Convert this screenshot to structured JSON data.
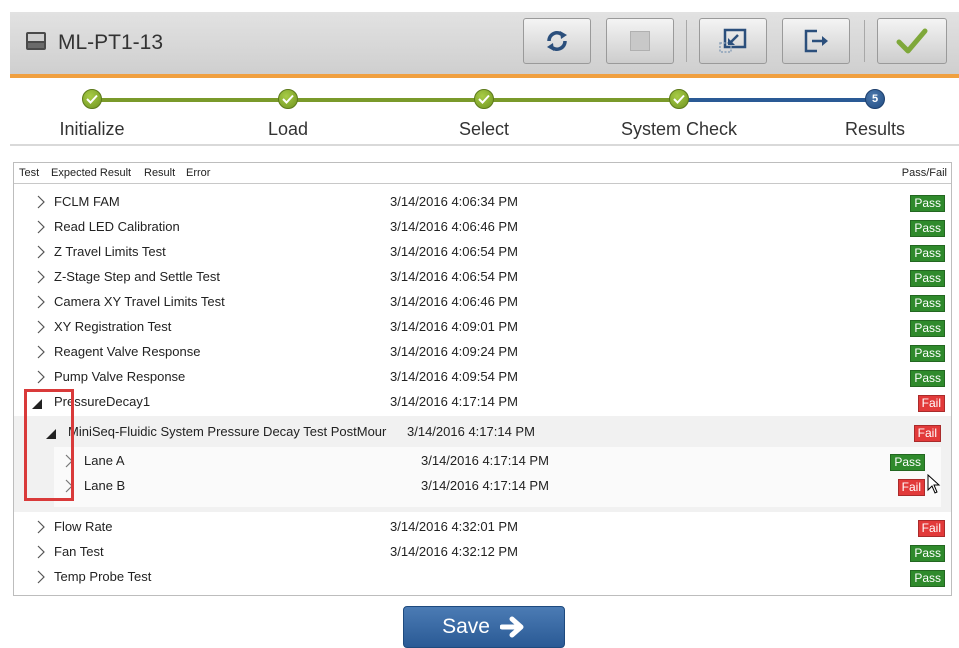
{
  "window": {
    "title": "ML-PT1-13"
  },
  "toolbar": {
    "buttons": [
      {
        "name": "refresh-button",
        "icon": "refresh-icon"
      },
      {
        "name": "stop-button",
        "icon": "stop-icon"
      },
      {
        "name": "minimize-button",
        "icon": "minimize-window-icon"
      },
      {
        "name": "exit-button",
        "icon": "exit-icon"
      },
      {
        "name": "confirm-button",
        "icon": "checkmark-icon"
      }
    ]
  },
  "steps": [
    {
      "label": "Initialize",
      "state": "done"
    },
    {
      "label": "Load",
      "state": "done"
    },
    {
      "label": "Select",
      "state": "done"
    },
    {
      "label": "System Check",
      "state": "done"
    },
    {
      "label": "Results",
      "state": "current",
      "number": "5"
    }
  ],
  "table": {
    "headers": {
      "test": "Test",
      "expected": "Expected Result",
      "result": "Result",
      "error": "Error",
      "passfail": "Pass/Fail"
    },
    "rows": [
      {
        "name": "FCLM FAM",
        "time": "3/14/2016 4:06:34 PM",
        "status": "Pass"
      },
      {
        "name": "Read LED Calibration",
        "time": "3/14/2016 4:06:46 PM",
        "status": "Pass"
      },
      {
        "name": "Z Travel Limits Test",
        "time": "3/14/2016 4:06:54 PM",
        "status": "Pass"
      },
      {
        "name": "Z-Stage Step and Settle Test",
        "time": "3/14/2016 4:06:54 PM",
        "status": "Pass"
      },
      {
        "name": "Camera XY Travel Limits Test",
        "time": "3/14/2016 4:06:46 PM",
        "status": "Pass"
      },
      {
        "name": "XY Registration Test",
        "time": "3/14/2016 4:09:01 PM",
        "status": "Pass"
      },
      {
        "name": "Reagent Valve Response",
        "time": "3/14/2016 4:09:24 PM",
        "status": "Pass"
      },
      {
        "name": "Pump Valve Response",
        "time": "3/14/2016 4:09:54 PM",
        "status": "Pass"
      },
      {
        "name": "PressureDecay1",
        "time": "3/14/2016 4:17:14 PM",
        "status": "Fail"
      },
      {
        "name": "MiniSeq-Fluidic System Pressure Decay Test PostMour",
        "time": "3/14/2016 4:17:14 PM",
        "status": "Fail"
      },
      {
        "name": "Lane A",
        "time": "3/14/2016 4:17:14 PM",
        "status": "Pass"
      },
      {
        "name": "Lane B",
        "time": "3/14/2016 4:17:14 PM",
        "status": "Fail"
      },
      {
        "name": "Flow Rate",
        "time": "3/14/2016 4:32:01 PM",
        "status": "Fail"
      },
      {
        "name": "Fan Test",
        "time": "3/14/2016 4:32:12 PM",
        "status": "Pass"
      },
      {
        "name": "Temp Probe Test",
        "time": "",
        "status": "Pass"
      }
    ]
  },
  "footer": {
    "save_label": "Save"
  },
  "colors": {
    "accent_orange": "#f0a040",
    "step_done": "#7a9a2a",
    "step_current": "#2a5a95",
    "pass": "#2f8a2c",
    "fail": "#e23a3a"
  }
}
